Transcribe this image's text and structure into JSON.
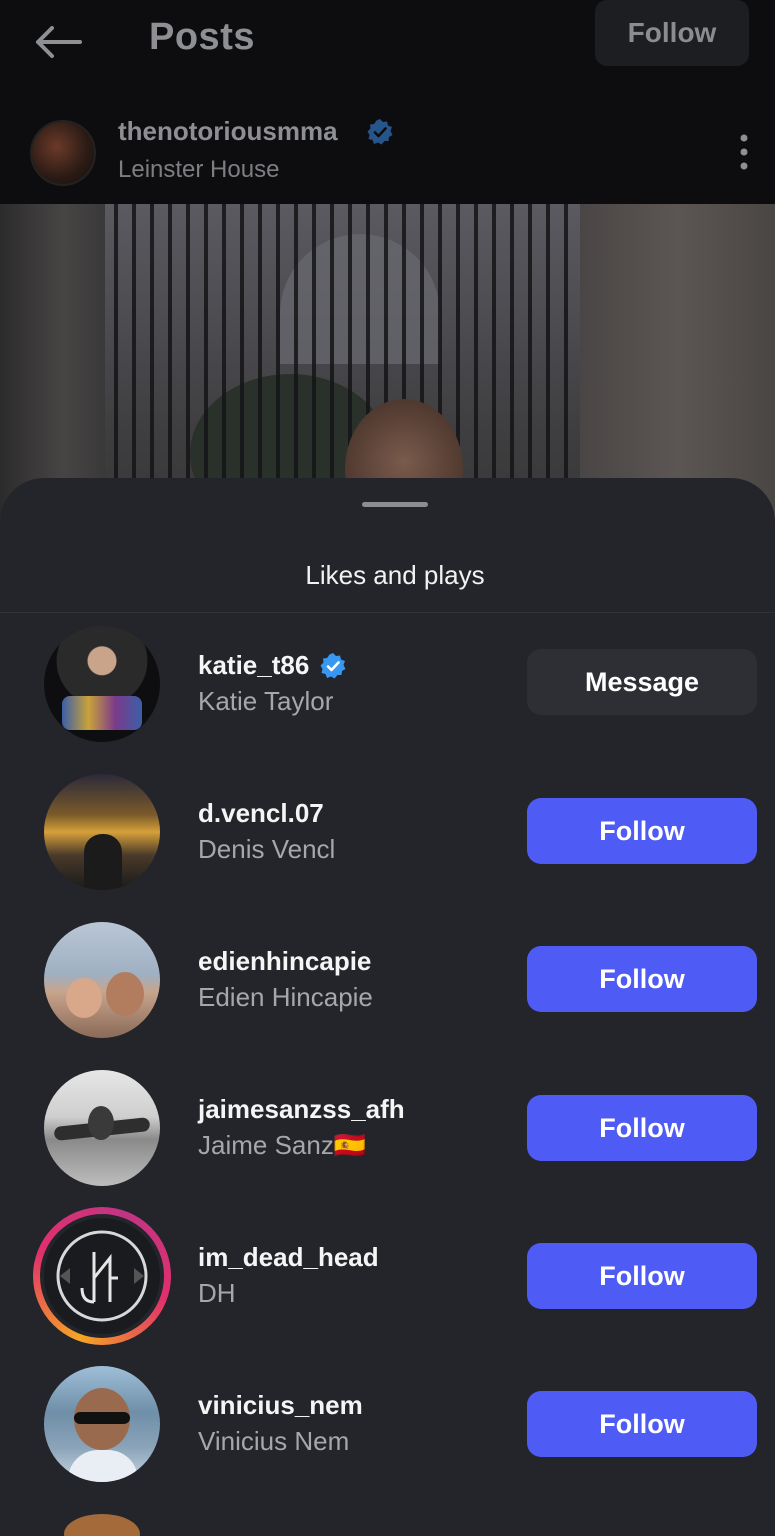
{
  "topbar": {
    "title": "Posts",
    "follow_label": "Follow"
  },
  "post": {
    "username": "thenotoriousmma",
    "location": "Leinster House"
  },
  "sheet": {
    "title": "Likes and plays"
  },
  "colors": {
    "accent": "#4f5bf5",
    "verified": "#3897f0",
    "sheet_bg": "#23252a"
  },
  "users": [
    {
      "username": "katie_t86",
      "name": "Katie Taylor",
      "verified": true,
      "button": "Message"
    },
    {
      "username": "d.vencl.07",
      "name": "Denis Vencl",
      "verified": false,
      "button": "Follow"
    },
    {
      "username": "edienhincapie",
      "name": "Edien Hincapie",
      "verified": false,
      "button": "Follow"
    },
    {
      "username": "jaimesanzss_afh",
      "name": "Jaime Sanz🇪🇸",
      "verified": false,
      "button": "Follow"
    },
    {
      "username": "im_dead_head",
      "name": "DH",
      "verified": false,
      "button": "Follow",
      "story": true
    },
    {
      "username": "vinicius_nem",
      "name": "Vinicius Nem",
      "verified": false,
      "button": "Follow"
    }
  ]
}
